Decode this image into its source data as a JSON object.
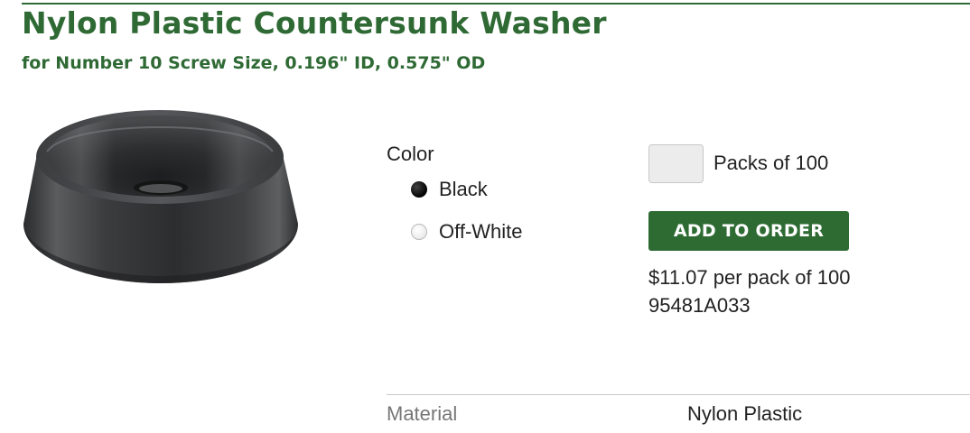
{
  "product": {
    "title": "Nylon Plastic Countersunk Washer",
    "subtitle": "for Number 10 Screw Size, 0.196\" ID, 0.575\" OD",
    "image": "black-countersunk-washer-photo"
  },
  "options": {
    "color_label": "Color",
    "colors": [
      {
        "label": "Black",
        "selected": true
      },
      {
        "label": "Off-White",
        "selected": false
      }
    ]
  },
  "order": {
    "quantity_value": "",
    "quantity_label": "Packs of 100",
    "add_button_label": "ADD TO ORDER",
    "price": "$11.07 per pack of 100",
    "part_number": "95481A033"
  },
  "specs": [
    {
      "label": "Material",
      "value": "Nylon Plastic"
    }
  ],
  "colors": {
    "brand_green": "#2f6a35",
    "button_green": "#2e6b33"
  }
}
